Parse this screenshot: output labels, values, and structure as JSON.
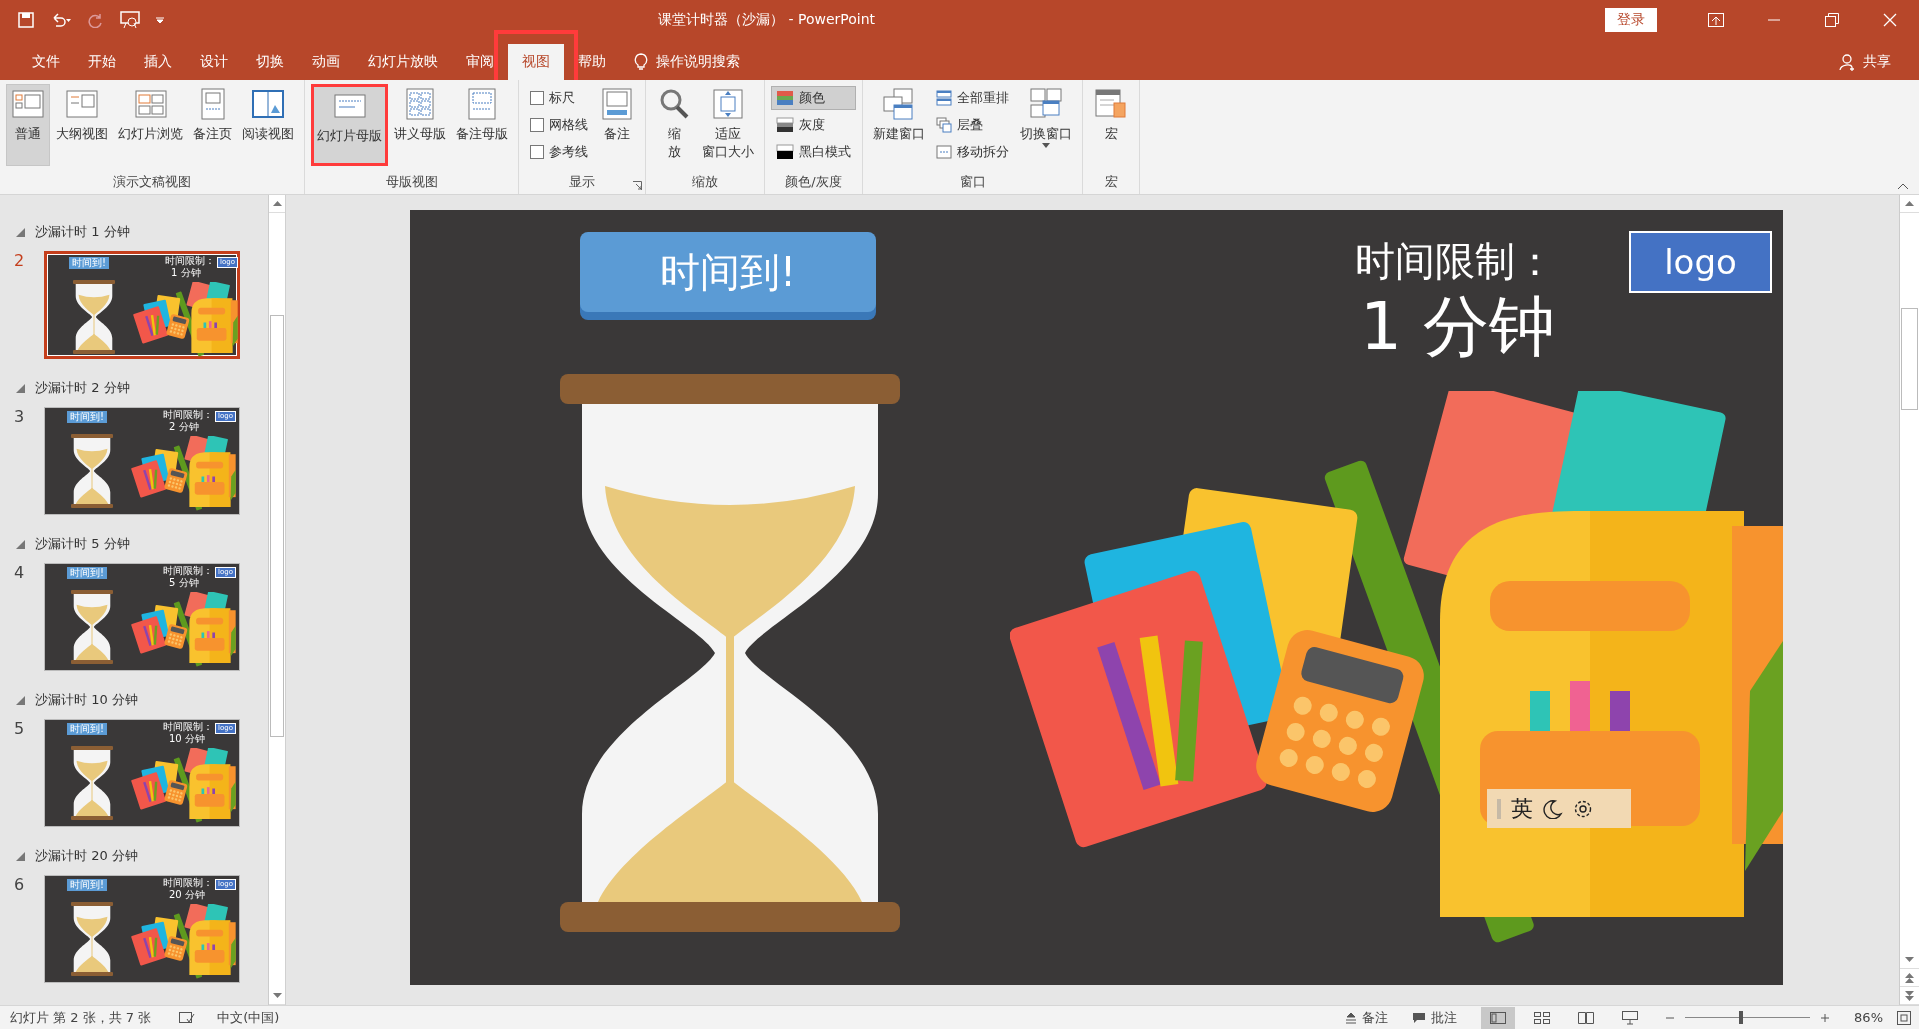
{
  "window": {
    "title": "课堂计时器（沙漏） - PowerPoint",
    "sign_in": "登录"
  },
  "tabs": [
    {
      "label": "文件",
      "selected": false,
      "annotated": false
    },
    {
      "label": "开始",
      "selected": false,
      "annotated": false
    },
    {
      "label": "插入",
      "selected": false,
      "annotated": false
    },
    {
      "label": "设计",
      "selected": false,
      "annotated": false
    },
    {
      "label": "切换",
      "selected": false,
      "annotated": false
    },
    {
      "label": "动画",
      "selected": false,
      "annotated": false
    },
    {
      "label": "幻灯片放映",
      "selected": false,
      "annotated": false
    },
    {
      "label": "审阅",
      "selected": false,
      "annotated": false
    },
    {
      "label": "视图",
      "selected": true,
      "annotated": true
    },
    {
      "label": "帮助",
      "selected": false,
      "annotated": false
    }
  ],
  "tell_me": "操作说明搜索",
  "share": "共享",
  "ribbon": {
    "groups": [
      {
        "label": "演示文稿视图",
        "items": [
          {
            "kind": "large",
            "label": "普通",
            "selected": true
          },
          {
            "kind": "large",
            "label": "大纲视图",
            "selected": false
          },
          {
            "kind": "large",
            "label": "幻灯片浏览",
            "selected": false
          },
          {
            "kind": "large",
            "label": "备注页",
            "selected": false
          },
          {
            "kind": "large",
            "label": "阅读视图",
            "selected": false
          }
        ]
      },
      {
        "label": "母版视图",
        "items": [
          {
            "kind": "large",
            "label": "幻灯片母版",
            "selected": true,
            "annotated": true
          },
          {
            "kind": "large",
            "label": "讲义母版",
            "selected": false
          },
          {
            "kind": "large",
            "label": "备注母版",
            "selected": false
          }
        ]
      },
      {
        "label": "显示",
        "launcher": true,
        "items": [
          {
            "kind": "check",
            "label": "标尺",
            "checked": false
          },
          {
            "kind": "check",
            "label": "网格线",
            "checked": false
          },
          {
            "kind": "check",
            "label": "参考线",
            "checked": false
          },
          {
            "kind": "large",
            "label": "备注",
            "selected": false
          }
        ]
      },
      {
        "label": "缩放",
        "items": [
          {
            "kind": "large",
            "lines": [
              "缩",
              "放"
            ],
            "selected": false
          },
          {
            "kind": "large",
            "lines": [
              "适应",
              "窗口大小"
            ],
            "selected": false
          }
        ]
      },
      {
        "label": "颜色/灰度",
        "items": [
          {
            "kind": "small",
            "label": "颜色",
            "selected": true
          },
          {
            "kind": "small",
            "label": "灰度",
            "selected": false
          },
          {
            "kind": "small",
            "label": "黑白模式",
            "selected": false
          }
        ]
      },
      {
        "label": "窗口",
        "items": [
          {
            "kind": "large",
            "label": "新建窗口",
            "selected": false
          },
          {
            "kind": "small",
            "label": "全部重排",
            "selected": false
          },
          {
            "kind": "small",
            "label": "层叠",
            "selected": false
          },
          {
            "kind": "small",
            "label": "移动拆分",
            "selected": false
          },
          {
            "kind": "large",
            "label": "切换窗口",
            "dropdown": true,
            "selected": false
          }
        ]
      },
      {
        "label": "宏",
        "items": [
          {
            "kind": "large",
            "label": "宏",
            "selected": false
          }
        ]
      }
    ]
  },
  "sections": [
    {
      "title": "沙漏计时 1 分钟",
      "expanded": true,
      "slides": [
        {
          "number": "2",
          "selected": true,
          "thumb": {
            "badge": "时间到!",
            "limit": "时间限制：",
            "duration": "1 分钟",
            "logo": "logo"
          }
        }
      ]
    },
    {
      "title": "沙漏计时 2 分钟",
      "expanded": true,
      "slides": [
        {
          "number": "3",
          "selected": false,
          "thumb": {
            "badge": "时间到!",
            "limit": "时间限制：",
            "duration": "2 分钟",
            "logo": "logo"
          }
        }
      ]
    },
    {
      "title": "沙漏计时 5 分钟",
      "expanded": true,
      "slides": [
        {
          "number": "4",
          "selected": false,
          "thumb": {
            "badge": "时间到!",
            "limit": "时间限制：",
            "duration": "5 分钟",
            "logo": "logo"
          }
        }
      ]
    },
    {
      "title": "沙漏计时 10 分钟",
      "expanded": true,
      "slides": [
        {
          "number": "5",
          "selected": false,
          "thumb": {
            "badge": "时间到!",
            "limit": "时间限制：",
            "duration": "10 分钟",
            "logo": "logo"
          }
        }
      ]
    },
    {
      "title": "沙漏计时 20 分钟",
      "expanded": true,
      "slides": [
        {
          "number": "6",
          "selected": false,
          "thumb": {
            "badge": "时间到!",
            "limit": "时间限制：",
            "duration": "20 分钟",
            "logo": "logo"
          }
        }
      ]
    }
  ],
  "slide": {
    "badge": "时间到!",
    "limit_label": "时间限制：",
    "duration": "1 分钟",
    "logo": "logo"
  },
  "ime_bar": {
    "mode": "英"
  },
  "status_bar": {
    "slide_info": "幻灯片 第 2 张，共 7 张",
    "language": "中文(中国)",
    "notes": "备注",
    "comments": "批注",
    "views": [
      {
        "selected": true
      },
      {
        "selected": false
      },
      {
        "selected": false
      },
      {
        "selected": false
      }
    ],
    "zoom": {
      "level": 0.45,
      "reading": "86%"
    }
  }
}
